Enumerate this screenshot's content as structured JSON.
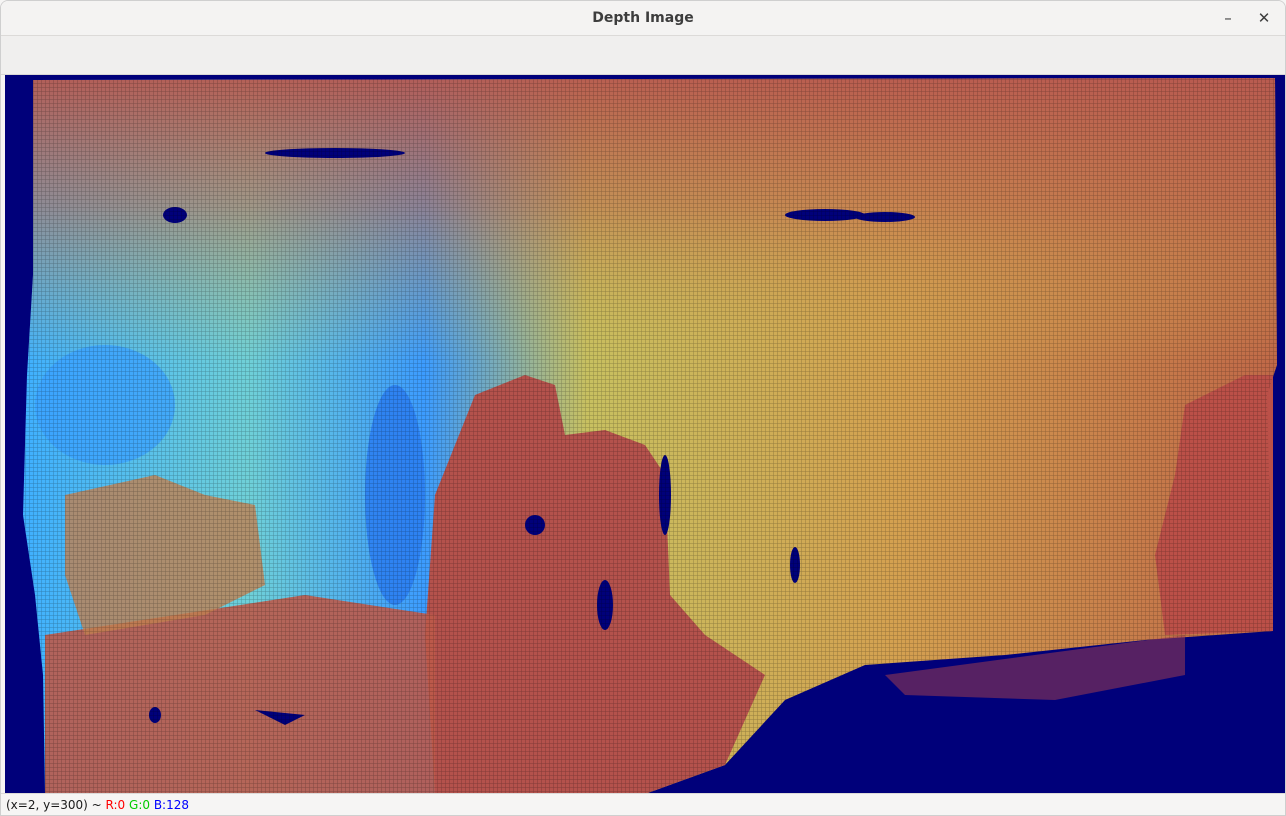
{
  "window": {
    "title": "Depth Image"
  },
  "controls": {
    "minimize_icon": "minimize-icon",
    "close_icon": "close-icon",
    "minimize_glyph": "–",
    "close_glyph": "✕"
  },
  "status": {
    "coords": "(x=2, y=300) ~ ",
    "r": "R:0",
    "g": "G:0",
    "b": "B:128"
  },
  "colors": {
    "background_invalid": "#00007a",
    "near": "#b0404a",
    "mid": "#c8a050",
    "far": "#2a8cff",
    "status_r": "#ff0000",
    "status_g": "#00cc00",
    "status_b": "#0000ff"
  }
}
